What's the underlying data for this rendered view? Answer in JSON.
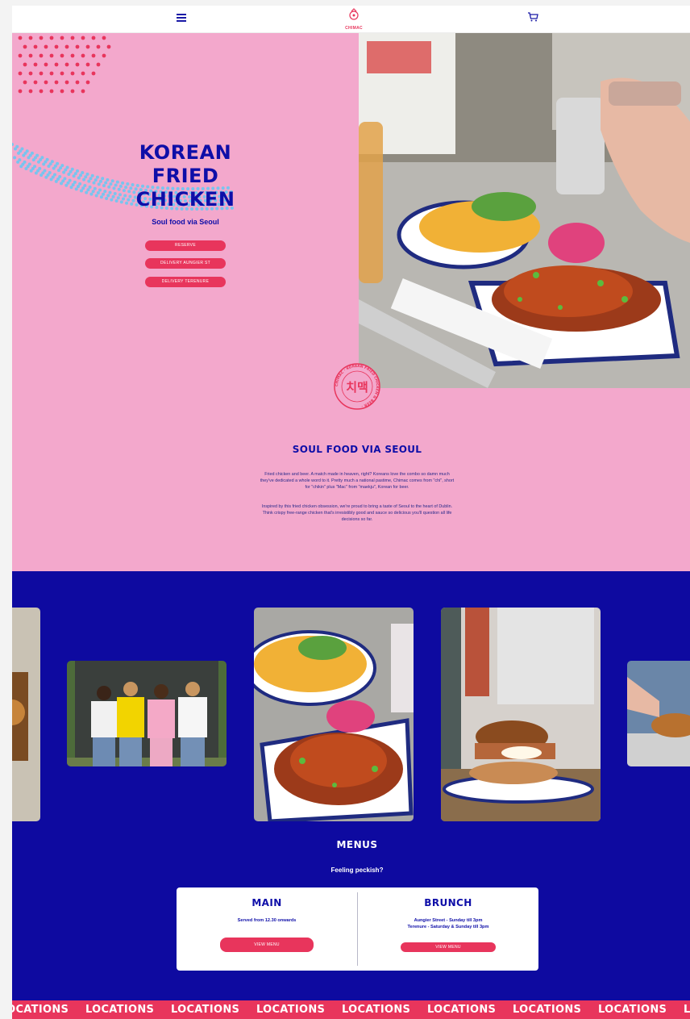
{
  "header": {
    "logo_text": "CHIMAC",
    "menu_icon": "hamburger-icon",
    "cart_icon": "cart-icon"
  },
  "hero": {
    "title_lines": [
      "KOREAN",
      "FRIED",
      "CHICKEN"
    ],
    "subtitle": "Soul food via Seoul",
    "buttons": [
      "RESERVE",
      "DELIVERY AUNGIER ST",
      "DELIVERY TERENURE"
    ]
  },
  "stamp": {
    "hangul": "치맥",
    "ring_text": "CHIMAC · KOREAN FRIED CHICKEN & BEER · "
  },
  "intro": {
    "title": "SOUL FOOD VIA SEOUL",
    "paragraph_1": "Fried chicken and beer. A match made in heaven, right? Koreans love the combo so damn much they've dedicated a whole word to it. Pretty much a national pastime, Chimac comes from \"chi\", short for \"chikin\" plus \"Mac\" from \"maekju\", Korean for beer.",
    "paragraph_2": "Inspired by this fried chicken obsession, we're proud to bring a taste of Seoul to the heart of Dublin. Think crispy free-range chicken that's irresistibly good and sauce so delicious you'll question all life decisions so far."
  },
  "menus": {
    "title": "MENUS",
    "subtitle": "Feeling peckish?",
    "main": {
      "title": "MAIN",
      "note": "Served from 12.30 onwards",
      "button": "VIEW MENU"
    },
    "brunch": {
      "title": "BRUNCH",
      "note_1": "Aungier Street - Sunday till 3pm",
      "note_2": "Terenure - Saturday & Sunday till 3pm",
      "button": "VIEW MENU"
    }
  },
  "marquee": {
    "word": "LOCATIONS"
  },
  "colors": {
    "pink": "#f3a8cc",
    "navy": "#0e0ea8",
    "red": "#e8355c",
    "blue_bg": "#0e0aa0"
  }
}
